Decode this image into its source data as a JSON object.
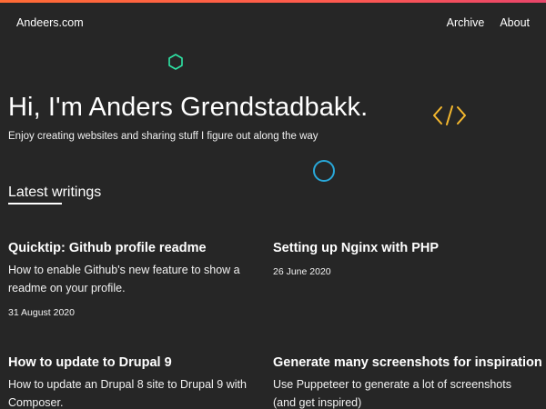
{
  "header": {
    "site_title": "Andeers.com",
    "nav": [
      {
        "label": "Archive"
      },
      {
        "label": "About"
      }
    ]
  },
  "hero": {
    "title": "Hi, I'm Anders Grendstadbakk.",
    "subtitle": "Enjoy creating websites and sharing stuff I figure out along the way"
  },
  "decorations": {
    "hex_color": "#2ee6a6",
    "code_color": "#f5b82e",
    "circle_color": "#29a8d9"
  },
  "section": {
    "heading": "Latest writings"
  },
  "posts": [
    {
      "title": "Quicktip: Github profile readme",
      "description": "How to enable Github's new feature to show a readme on your profile.",
      "date": "31 August 2020"
    },
    {
      "title": "Setting up Nginx with PHP",
      "description": "",
      "date": "26 June 2020"
    },
    {
      "title": "How to update to Drupal 9",
      "description": "How to update an Drupal 8 site to Drupal 9 with Composer.",
      "date": ""
    },
    {
      "title": "Generate many screenshots for inspiration",
      "description": "Use Puppeteer to generate a lot of screenshots (and get inspired)",
      "date": ""
    }
  ],
  "colors": {
    "background": "#262626",
    "text": "#ffffff",
    "top_bar_gradient": [
      "#ff6b35",
      "#e8456a"
    ]
  }
}
